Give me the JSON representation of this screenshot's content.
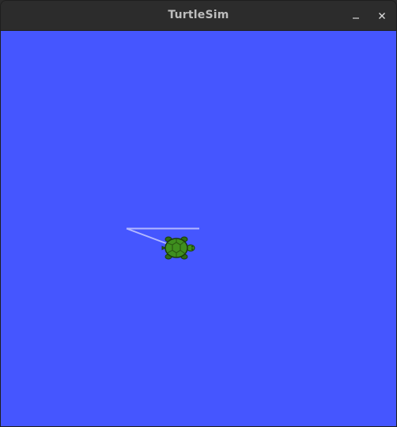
{
  "window": {
    "title": "TurtleSim",
    "controls": {
      "minimize_icon": "minimize-icon",
      "close_icon": "close-icon"
    }
  },
  "canvas": {
    "background_color": "#4556ff",
    "pen_color": "#b3b8ff",
    "turtle_colors": {
      "shell": "#3f8f1e",
      "shell_pattern": "#2a5c12",
      "body": "#2e6b14",
      "outline": "#1a3a0a"
    }
  }
}
